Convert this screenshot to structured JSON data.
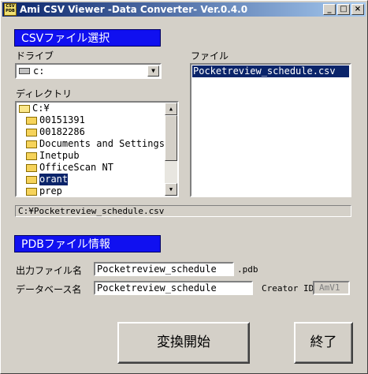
{
  "window": {
    "title": "Ami CSV Viewer -Data Converter-  Ver.0.4.0",
    "icon_text": "CSV PDB",
    "buttons": {
      "minimize": "_",
      "maximize": "□",
      "close": "×"
    }
  },
  "csv_section": {
    "heading": "CSVファイル選択",
    "drive_label": "ドライブ",
    "drive_value": "c:",
    "directory_label": "ディレクトリ",
    "directories": [
      {
        "name": "C:¥",
        "open": true,
        "selected": false
      },
      {
        "name": "00151391",
        "open": false,
        "selected": false
      },
      {
        "name": "00182286",
        "open": false,
        "selected": false
      },
      {
        "name": "Documents and Settings",
        "open": false,
        "selected": false
      },
      {
        "name": "Inetpub",
        "open": false,
        "selected": false
      },
      {
        "name": "OfficeScan NT",
        "open": false,
        "selected": false
      },
      {
        "name": "orant",
        "open": false,
        "selected": true
      },
      {
        "name": "prep",
        "open": false,
        "selected": false
      }
    ],
    "file_label": "ファイル",
    "files": [
      "Pocketreview_schedule.csv"
    ],
    "selected_path": "C:¥Pocketreview_schedule.csv"
  },
  "pdb_section": {
    "heading": "PDBファイル情報",
    "output_name_label": "出力ファイル名",
    "output_name_value": "Pocketreview_schedule",
    "output_ext": ".pdb",
    "db_name_label": "データベース名",
    "db_name_value": "Pocketreview_schedule",
    "creator_label": "Creator ID",
    "creator_value": "AmV1"
  },
  "actions": {
    "convert_label": "変換開始",
    "exit_label": "終了"
  },
  "colors": {
    "face": "#d4d0c8",
    "heading_bg": "#1010f0",
    "selection": "#0a246a"
  }
}
